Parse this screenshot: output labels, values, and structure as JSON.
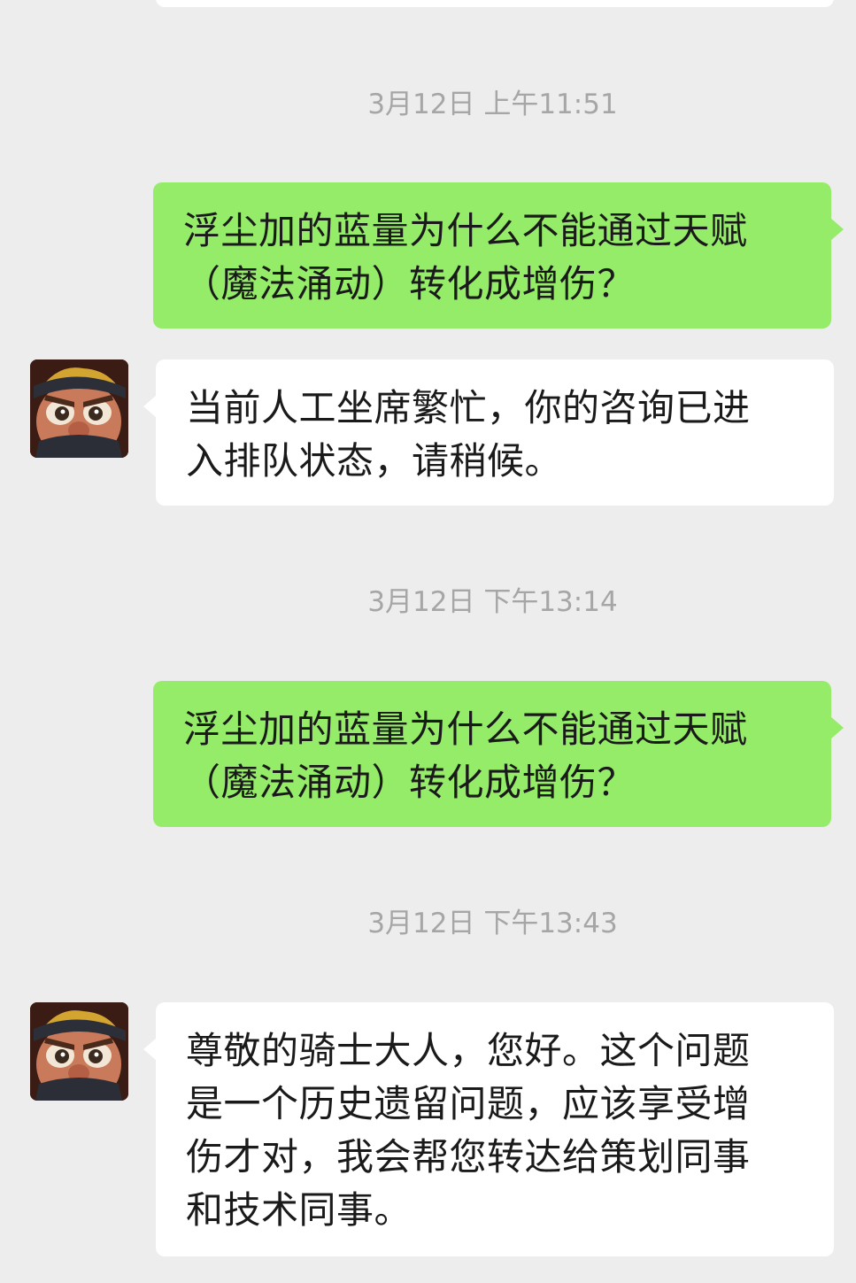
{
  "chat": {
    "timestamps": [
      "3月12日 上午11:51",
      "3月12日 下午13:14",
      "3月12日 下午13:43"
    ],
    "messages": [
      {
        "sender": "me",
        "text": "浮尘加的蓝量为什么不能通过天赋\n（魔法涌动）转化成增伤？"
      },
      {
        "sender": "them",
        "text": "当前人工坐席繁忙，你的咨询已进\n入排队状态，请稍候。"
      },
      {
        "sender": "me",
        "text": "浮尘加的蓝量为什么不能通过天赋\n（魔法涌动）转化成增伤？"
      },
      {
        "sender": "them",
        "text": "尊敬的骑士大人，您好。这个问题\n是一个历史遗留问题，应该享受增\n伤才对，我会帮您转达给策划同事\n和技术同事。"
      }
    ],
    "avatar_icon": "cartoon-warrior-avatar-icon"
  },
  "colors": {
    "background": "#ededed",
    "my_bubble": "#95ec69",
    "their_bubble": "#ffffff",
    "timestamp_text": "#a6a6a6"
  }
}
